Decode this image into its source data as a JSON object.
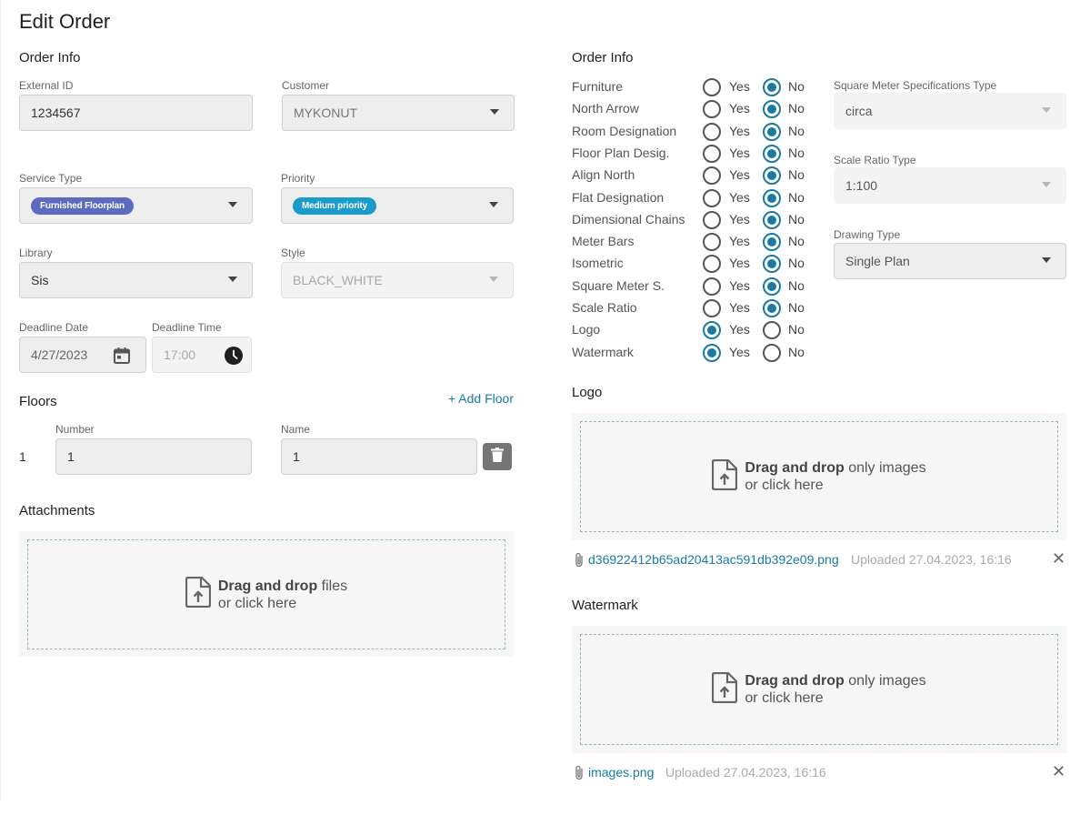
{
  "page": {
    "title": "Edit Order"
  },
  "left": {
    "order_info_title": "Order Info",
    "external_id": {
      "label": "External ID",
      "value": "1234567"
    },
    "customer": {
      "label": "Customer",
      "value": "MYKONUT"
    },
    "service_type": {
      "label": "Service Type",
      "value": "Furnished Floorplan",
      "chip_color": "#5c6bc0"
    },
    "priority": {
      "label": "Priority",
      "value": "Medium priority",
      "chip_color": "#1a9bc9"
    },
    "library": {
      "label": "Library",
      "value": "Sis"
    },
    "style": {
      "label": "Style",
      "value": "BLACK_WHITE"
    },
    "deadline_date": {
      "label": "Deadline Date",
      "value": "4/27/2023"
    },
    "deadline_time": {
      "label": "Deadline Time",
      "value": "17:00"
    },
    "floors": {
      "title": "Floors",
      "add_label": "+ Add Floor",
      "number_label": "Number",
      "name_label": "Name",
      "rows": [
        {
          "index": "1",
          "number": "1",
          "name": "1"
        }
      ]
    },
    "attachments": {
      "title": "Attachments",
      "drop_bold": "Drag and drop",
      "drop_rest": " files",
      "drop_line2": "or click here"
    }
  },
  "right": {
    "order_info_title": "Order Info",
    "yes_label": "Yes",
    "no_label": "No",
    "options": [
      {
        "label": "Furniture",
        "value": "No"
      },
      {
        "label": "North Arrow",
        "value": "No"
      },
      {
        "label": "Room Designation",
        "value": "No"
      },
      {
        "label": "Floor Plan Desig.",
        "value": "No"
      },
      {
        "label": "Align North",
        "value": "No"
      },
      {
        "label": "Flat Designation",
        "value": "No"
      },
      {
        "label": "Dimensional Chains",
        "value": "No"
      },
      {
        "label": "Meter Bars",
        "value": "No"
      },
      {
        "label": "Isometric",
        "value": "No"
      },
      {
        "label": "Square Meter S.",
        "value": "No"
      },
      {
        "label": "Scale Ratio",
        "value": "No"
      },
      {
        "label": "Logo",
        "value": "Yes"
      },
      {
        "label": "Watermark",
        "value": "Yes"
      }
    ],
    "sqm_type": {
      "label": "Square Meter Specifications Type",
      "value": "circa"
    },
    "scale_type": {
      "label": "Scale Ratio Type",
      "value": "1:100"
    },
    "drawing_type": {
      "label": "Drawing Type",
      "value": "Single Plan"
    },
    "logo": {
      "title": "Logo",
      "drop_bold": "Drag and drop",
      "drop_rest": " only images",
      "drop_line2": "or click here",
      "file_name": "d36922412b65ad20413ac591db392e09.png",
      "uploaded": "Uploaded 27.04.2023, 16:16"
    },
    "watermark": {
      "title": "Watermark",
      "drop_bold": "Drag and drop",
      "drop_rest": " only images",
      "drop_line2": "or click here",
      "file_name": "images.png",
      "uploaded": "Uploaded 27.04.2023, 16:16"
    }
  },
  "icons": {
    "calendar": "calendar-icon",
    "clock": "clock-icon",
    "delete": "trash-icon",
    "upload": "file-upload-icon",
    "paperclip": "paperclip-icon",
    "close": "close-icon",
    "dropdown": "chevron-down-icon"
  },
  "colors": {
    "accent": "#1a7aa3"
  }
}
